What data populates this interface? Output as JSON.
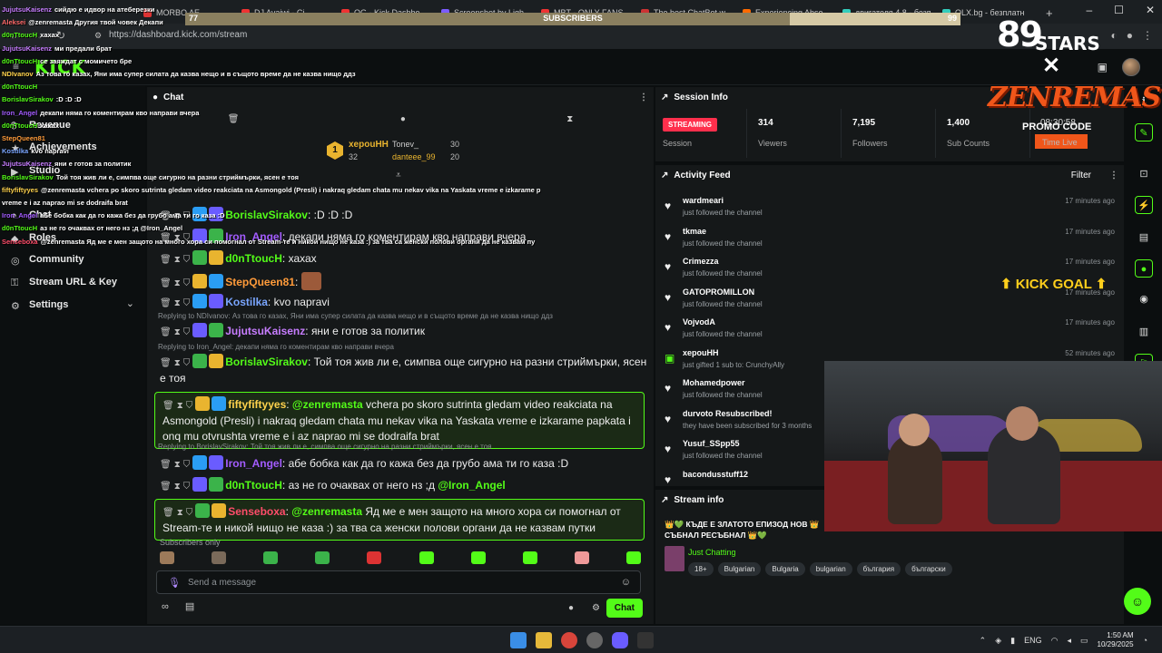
{
  "browser": {
    "tabs": [
      {
        "label": "MORBO AE",
        "color": "#d33"
      },
      {
        "label": "DJ Avaiwi - Ci",
        "color": "#e33"
      },
      {
        "label": "OG - Kick Dashbo",
        "color": "#e33"
      },
      {
        "label": "Screenshot by Ligh",
        "color": "#7b5cff"
      },
      {
        "label": "MBT - ONLY FANS",
        "color": "#e33"
      },
      {
        "label": "The best ChatBot w",
        "color": "#c33"
      },
      {
        "label": "Experiencing Abso",
        "color": "#ff6a00"
      },
      {
        "label": "двигателя 4.8 - безп",
        "color": "#3cb"
      },
      {
        "label": "OLX.bg - безплатн",
        "color": "#3cb"
      }
    ],
    "url": "https://dashboard.kick.com/stream",
    "new_tab": "+",
    "win": {
      "min": "–",
      "max": "☐",
      "close": "✕"
    }
  },
  "header": {
    "logo": "KICK"
  },
  "sidebar": {
    "items": [
      {
        "label": "Revenue",
        "icon": "revenue-icon"
      },
      {
        "label": "Achievements",
        "icon": "trophy-icon"
      },
      {
        "label": "Studio",
        "icon": "studio-icon"
      },
      {
        "label": "Chat",
        "icon": "chat-icon"
      },
      {
        "label": "Roles",
        "icon": "roles-icon"
      },
      {
        "label": "Community",
        "icon": "community-icon"
      },
      {
        "label": "Stream URL & Key",
        "icon": "key-icon"
      },
      {
        "label": "Settings",
        "icon": "gear-icon",
        "chevron": "⌄"
      }
    ]
  },
  "chat": {
    "title": "Chat",
    "menu": "⋮",
    "leaderboard": {
      "top": {
        "rank": "1",
        "name": "xepouHH",
        "value": "32"
      },
      "others": [
        {
          "name": "Tonev_",
          "value": "30"
        },
        {
          "name": "danteee_99",
          "value": "20"
        }
      ]
    },
    "messages": [
      {
        "user": "BorislavSirakov",
        "user_color": "#53fc18",
        "text": ":D :D :D"
      },
      {
        "user": "Iron_Angel",
        "user_color": "#a35cff",
        "text": "декапи няма го коментирам кво направи вчера"
      },
      {
        "user": "d0nTtoucH",
        "user_color": "#53fc18",
        "text": "хахах"
      },
      {
        "user": "StepQueen81",
        "user_color": "#ff9b3a",
        "text": ""
      },
      {
        "user": "Kostilka",
        "user_color": "#7aa6ff",
        "text": "kvo napravi"
      },
      {
        "reply": "Replying to NDIvanov: Аз това го казах, Яни има супер силата да казва нещо и в същото време да не казва нищо ддз",
        "user": "JujutsuKaisenz",
        "user_color": "#c77dff",
        "text": "яни е готов за политик"
      },
      {
        "reply": "Replying to Iron_Angel: декапи няма го коментирам кво направи вчера",
        "user": "BorislavSirakov",
        "user_color": "#53fc18",
        "text": "Той тоя жив ли е, симпва още сигурно на разни стриймърки, ясен е тоя"
      },
      {
        "user": "fiftyfiftyyes",
        "user_color": "#ffd34d",
        "mention": "@zenremasta",
        "text": "vchera po skoro sutrinta gledam video reakciata na Asmongold (Presli) i nakraq gledam chata mu nekav vika na Yaskata vreme e izkarame papkata i onq mu otvrushta vreme e i az naprao mi se dodraifa brat"
      },
      {
        "reply": "Replying to BorislavSirakov: Той тоя жив ли е, симпва още сигурно на разни стриймърки, ясен е тоя",
        "user": "Iron_Angel",
        "user_color": "#a35cff",
        "text": "абе бобка как да го кажа без да грубо ама ти го каза :D"
      },
      {
        "user": "d0nTtoucH",
        "user_color": "#53fc18",
        "text": "аз не го очаквах от него нз ;д",
        "mention": "@Iron_Angel"
      },
      {
        "user": "Senseboxa",
        "user_color": "#ff4d6a",
        "mention": "@zenremasta",
        "text": "Яд ме е мен защото на много хора си помогнал от Stream-те и никой нищо не каза :) за тва са женски полови органи да не казвам путки"
      }
    ],
    "subs_only": "Subscribers only",
    "input_placeholder": "Send a message",
    "send_label": "Chat"
  },
  "session": {
    "title": "Session Info",
    "badge": "STREAMING",
    "session_label": "Session",
    "viewers": "314",
    "viewers_label": "Viewers",
    "followers": "7,195",
    "followers_label": "Followers",
    "subs": "1,400",
    "subs_label": "Sub Counts",
    "uptime": "08:30:58",
    "uptime_label": "Time Live"
  },
  "activity": {
    "title": "Activity Feed",
    "filter": "Filter",
    "items": [
      {
        "who": "wardmeari",
        "what": "just followed the channel",
        "when": "17 minutes ago"
      },
      {
        "who": "tkmae",
        "what": "just followed the channel",
        "when": "17 minutes ago"
      },
      {
        "who": "Crimezza",
        "what": "just followed the channel",
        "when": "17 minutes ago"
      },
      {
        "who": "GATOPROMILLON",
        "what": "just followed the channel",
        "when": "17 minutes ago"
      },
      {
        "who": "VojvodA",
        "what": "just followed the channel",
        "when": "17 minutes ago"
      },
      {
        "who": "xepouHH",
        "what": "just gifted 1 sub to: CrunchyAlly",
        "when": "52 minutes ago"
      },
      {
        "who": "Mohamedpower",
        "what": "just followed the channel",
        "when": ""
      },
      {
        "who": "durvoto Resubscribed!",
        "what": "they have been subscribed for 3 months",
        "when": ""
      },
      {
        "who": "Yusuf_SSpp55",
        "what": "just followed the channel",
        "when": ""
      },
      {
        "who": "bacondusstuff12",
        "what": "",
        "when": ""
      }
    ]
  },
  "stream_info": {
    "title": "Stream info",
    "stream_title": "👑💚 КЪДЕ Е ЗЛАТОТО ЕПИЗОД НОВ 👑 СЪБНАЛ РЕСЪБНАЛ 👑💚",
    "category": "Just Chatting",
    "tags": [
      "18+",
      "Bulgarian",
      "Bulgaria",
      "bulgarian",
      "българия",
      "български"
    ]
  },
  "overlay": {
    "subscribers_label": "SUBSCRIBERS",
    "sub_current": "77",
    "sub_goal": "99",
    "sub_progress": 0.78,
    "brand_num": "89",
    "brand_stars": "STARS",
    "brand_x": "✕",
    "brand_name": "ZENREMASTA",
    "promo": "PROMO CODE",
    "goal": "⬆ KICK GOAL ⬆",
    "chat_lines": [
      {
        "u": "JujutsuKaisenz",
        "c": "#c77dff",
        "t": "сийдю е идвор на атеберезки"
      },
      {
        "u": "Aleksei",
        "c": "#ff6a6a",
        "t": "@zenremasta Другия твой човек Декапи"
      },
      {
        "u": "d0nTtoucH",
        "c": "#53fc18",
        "t": "хахах"
      },
      {
        "u": "JujutsuKaisenz",
        "c": "#c77dff",
        "t": "ми предали брат"
      },
      {
        "u": "d0nTtoucH",
        "c": "#53fc18",
        "t": "се заяждат с момичето бре"
      },
      {
        "u": "NDIvanov",
        "c": "#ffd34d",
        "t": "Аз това го казах, Яни има супер силата да казва нещо и в същото време да не казва нищо ддз"
      },
      {
        "u": "d0nTtoucH",
        "c": "#53fc18",
        "t": ""
      },
      {
        "u": "BorislavSirakov",
        "c": "#53fc18",
        "t": ":D :D :D"
      },
      {
        "u": "Iron_Angel",
        "c": "#a35cff",
        "t": "декапи няма го коментирам кво направи вчера"
      },
      {
        "u": "d0nTtoucH",
        "c": "#53fc18",
        "t": "хахах"
      },
      {
        "u": "StepQueen81",
        "c": "#ff9b3a",
        "t": ""
      },
      {
        "u": "Kostilka",
        "c": "#7aa6ff",
        "t": "kvo napravi"
      },
      {
        "u": "JujutsuKaisenz",
        "c": "#c77dff",
        "t": "яни е готов за политик"
      },
      {
        "u": "BorislavSirakov",
        "c": "#53fc18",
        "t": "Той тоя жив ли е, симпва още сигурно на разни стриймърки, ясен е тоя"
      },
      {
        "u": "fiftyfiftyyes",
        "c": "#ffd34d",
        "t": "@zenremasta vchera po skoro sutrinta gledam video reakciata na Asmongold (Presli) i nakraq gledam chata mu nekav vika na Yaskata vreme e izkarame p"
      },
      {
        "u": "",
        "c": "#fff",
        "t": "vreme e i az naprao mi se dodraifa brat"
      },
      {
        "u": "Iron_Angel",
        "c": "#a35cff",
        "t": "абе бобка как да го кажа без да грубо ама ти го каза :D"
      },
      {
        "u": "d0nTtoucH",
        "c": "#53fc18",
        "t": "аз не го очаквах от него нз ;д @Iron_Angel"
      },
      {
        "u": "Senseboxa",
        "c": "#ff4d6a",
        "t": "@zenremasta Яд ме е мен защото на много хора си помогнал от Stream-те и никой нищо не каза :) за тва са женски полови органи да не казвам пу"
      }
    ]
  },
  "taskbar": {
    "lang": "ENG",
    "time": "1:50 AM",
    "date": "10/29/2025"
  },
  "colors": {
    "accent": "#53fc18",
    "live": "#ff2f4c",
    "bg": "#0b0e0f",
    "panel": "#151819"
  }
}
